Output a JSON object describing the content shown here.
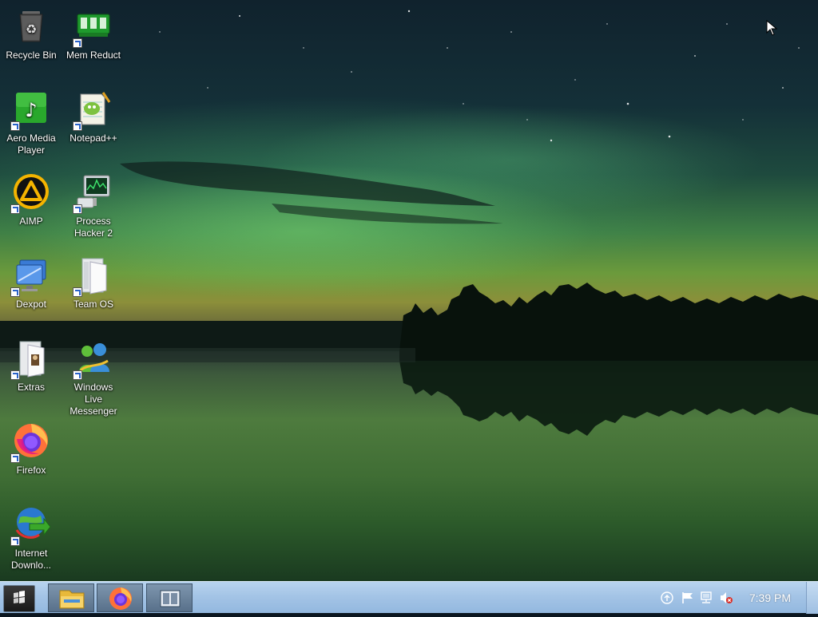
{
  "desktop": {
    "icons": [
      {
        "label": "Recycle Bin",
        "icon": "recycle-bin-icon"
      },
      {
        "label": "Mem Reduct",
        "icon": "memory-icon"
      },
      {
        "label": "Aero Media Player",
        "icon": "music-note-icon"
      },
      {
        "label": "Notepad++",
        "icon": "notepad-icon"
      },
      {
        "label": "AIMP",
        "icon": "aimp-icon"
      },
      {
        "label": "Process Hacker 2",
        "icon": "monitor-icon"
      },
      {
        "label": "Dexpot",
        "icon": "virtual-desktop-icon"
      },
      {
        "label": "Team OS",
        "icon": "folder-icon"
      },
      {
        "label": "Extras",
        "icon": "folder-icon"
      },
      {
        "label": "Windows Live Messenger",
        "icon": "messenger-icon"
      },
      {
        "label": "Firefox",
        "icon": "firefox-icon"
      },
      {
        "label": "Internet Downlo...",
        "icon": "download-globe-icon"
      }
    ]
  },
  "taskbar": {
    "start_icon": "windows-logo-icon",
    "pinned": [
      {
        "name": "File Explorer",
        "icon": "file-explorer-icon"
      },
      {
        "name": "Firefox",
        "icon": "firefox-icon"
      },
      {
        "name": "Task View",
        "icon": "task-view-icon"
      }
    ],
    "tray": {
      "icons": [
        "upload-icon",
        "flag-icon",
        "network-icon",
        "volume-muted-icon"
      ],
      "clock": "7:39 PM"
    }
  },
  "colors": {
    "taskbar_top": "#b8d4ef",
    "taskbar_bottom": "#93b8df",
    "aurora_green": "#6fcf5a"
  }
}
